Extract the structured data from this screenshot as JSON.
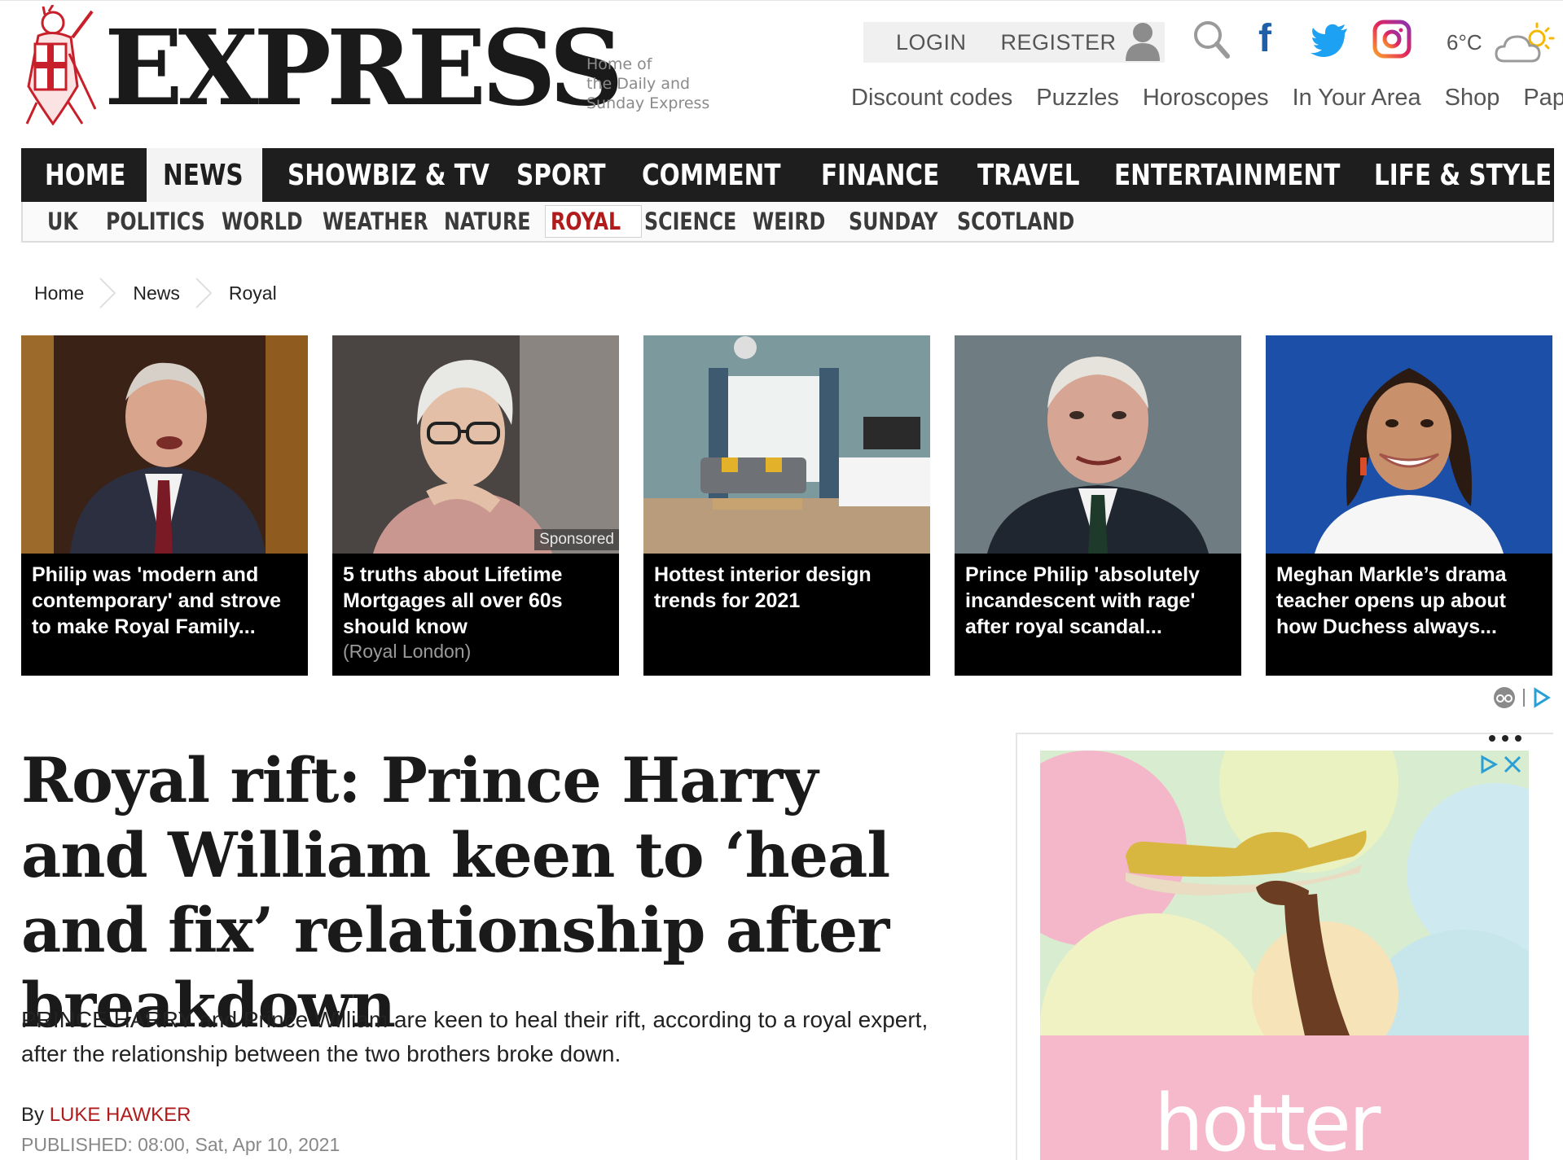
{
  "brand": {
    "wordmark": "EXPRESS",
    "tagline": [
      "Home of",
      "the Daily and",
      "Sunday Express"
    ]
  },
  "account": {
    "login": "LOGIN",
    "register": "REGISTER"
  },
  "weather": {
    "temperature": "6°C"
  },
  "top_links": [
    "Discount codes",
    "Puzzles",
    "Horoscopes",
    "In Your Area",
    "Shop",
    "Paper"
  ],
  "primary_nav": {
    "items": [
      {
        "label": "HOME"
      },
      {
        "label": "NEWS",
        "active": true
      },
      {
        "label": "SHOWBIZ & TV"
      },
      {
        "label": "SPORT"
      },
      {
        "label": "COMMENT"
      },
      {
        "label": "FINANCE"
      },
      {
        "label": "TRAVEL"
      },
      {
        "label": "ENTERTAINMENT"
      },
      {
        "label": "LIFE & STYLE"
      }
    ]
  },
  "secondary_nav": {
    "items": [
      {
        "label": "UK"
      },
      {
        "label": "POLITICS"
      },
      {
        "label": "WORLD"
      },
      {
        "label": "WEATHER"
      },
      {
        "label": "NATURE"
      },
      {
        "label": "ROYAL",
        "active": true
      },
      {
        "label": "SCIENCE"
      },
      {
        "label": "WEIRD"
      },
      {
        "label": "SUNDAY"
      },
      {
        "label": "SCOTLAND"
      }
    ]
  },
  "breadcrumb": [
    "Home",
    "News",
    "Royal"
  ],
  "cards": [
    {
      "caption": "Philip was 'modern and contemporary' and strove to make Royal Family..."
    },
    {
      "caption": "5 truths about Lifetime Mortgages all over 60s should know",
      "sponsor": "(Royal London)",
      "tag": "Sponsored"
    },
    {
      "caption": "Hottest interior design trends for 2021"
    },
    {
      "caption": "Prince Philip 'absolutely incandescent with rage' after royal scandal..."
    },
    {
      "caption": "Meghan Markle’s drama teacher opens up about how Duchess always..."
    }
  ],
  "article": {
    "headline": "Royal rift: Prince Harry and William keen to ‘heal and fix’ relationship after breakdown",
    "standfirst": "PRINCE HARRY and Prince William are keen to heal their rift, according to a royal expert, after the relationship between the two brothers broke down.",
    "by_label": "By",
    "author": "LUKE HAWKER",
    "published": "PUBLISHED: 08:00, Sat, Apr 10, 2021"
  },
  "ad": {
    "brand_text": "hotter"
  },
  "colors": {
    "accent_red": "#b01c1c",
    "nav_dark": "#1e1e1e",
    "facebook": "#1f5fa8",
    "twitter": "#1da1f2",
    "ad_pink": "#f6b8cb"
  }
}
